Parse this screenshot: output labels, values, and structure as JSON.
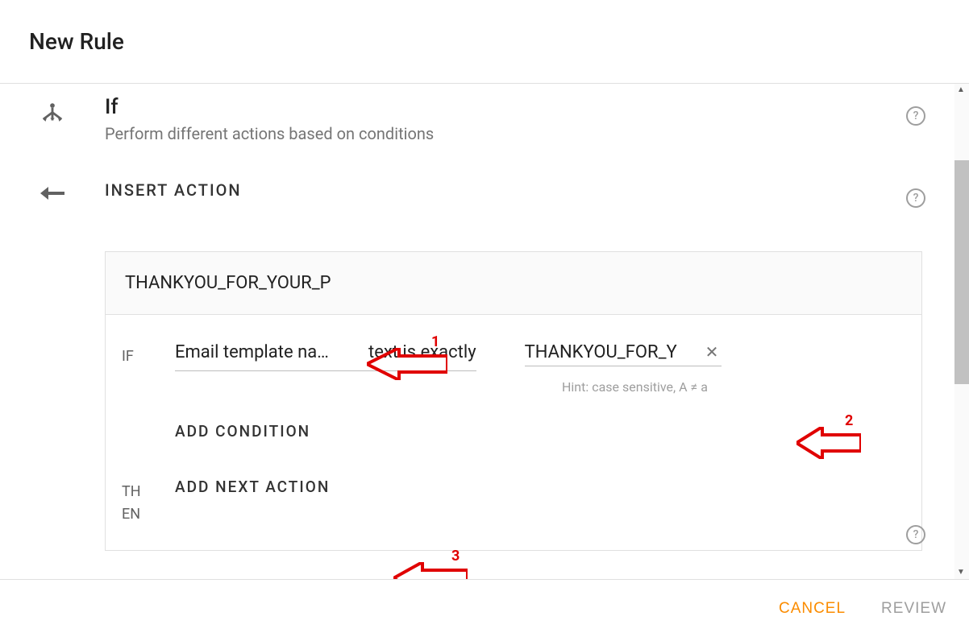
{
  "dialog": {
    "title": "New Rule"
  },
  "if_block": {
    "title": "If",
    "subtitle": "Perform different actions based on conditions"
  },
  "insert_action_label": "INSERT ACTION",
  "card": {
    "header_text": "THANKYOU_FOR_YOUR_P",
    "if_label": "IF",
    "then_label_1": "TH",
    "then_label_2": "EN",
    "condition": {
      "field": "Email template na…",
      "operator": "text is exactly",
      "value": "THANKYOU_FOR_Y",
      "clear_glyph": "✕",
      "hint": "Hint: case sensitive, A ≠ a"
    },
    "add_condition_label": "ADD CONDITION",
    "add_next_action_label": "ADD NEXT ACTION"
  },
  "footer": {
    "cancel": "CANCEL",
    "review": "REVIEW"
  },
  "annotations": {
    "a1": "1",
    "a2": "2",
    "a3": "3"
  },
  "icons": {
    "help": "?",
    "up": "▲",
    "down": "▼"
  }
}
